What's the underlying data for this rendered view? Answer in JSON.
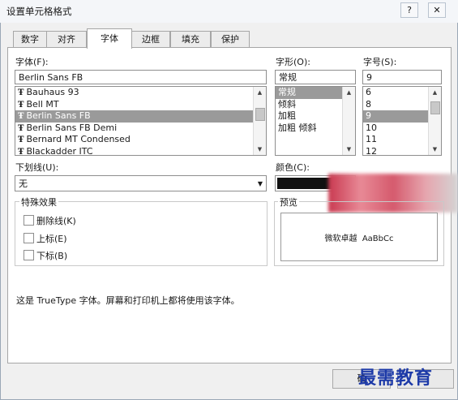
{
  "window": {
    "title": "设置单元格格式",
    "help_button": "?",
    "close_button": "✕"
  },
  "tabs": [
    {
      "label": "数字"
    },
    {
      "label": "对齐"
    },
    {
      "label": "字体"
    },
    {
      "label": "边框"
    },
    {
      "label": "填充"
    },
    {
      "label": "保护"
    }
  ],
  "font": {
    "label": "字体(F):",
    "value": "Berlin Sans FB",
    "list": [
      "Bauhaus 93",
      "Bell MT",
      "Berlin Sans FB",
      "Berlin Sans FB Demi",
      "Bernard MT Condensed",
      "Blackadder ITC"
    ],
    "selected_index": 2
  },
  "style": {
    "label": "字形(O):",
    "value": "常规",
    "list": [
      "常规",
      "倾斜",
      "加粗",
      "加粗 倾斜"
    ],
    "selected_index": 0
  },
  "size": {
    "label": "字号(S):",
    "value": "9",
    "list": [
      "6",
      "8",
      "9",
      "10",
      "11",
      "12"
    ],
    "selected_index": 2
  },
  "underline": {
    "label": "下划线(U):",
    "value": "无"
  },
  "color": {
    "label": "颜色(C):",
    "swatch": "#111111"
  },
  "effects": {
    "label": "特殊效果",
    "items": [
      {
        "label": "删除线(K)"
      },
      {
        "label": "上标(E)"
      },
      {
        "label": "下标(B)"
      }
    ]
  },
  "preview": {
    "label": "预览",
    "text": "微软卓越  AaBbCc"
  },
  "info_text": "这是 TrueType 字体。屏幕和打印机上都将使用该字体。",
  "ok_button": "确",
  "watermark": "最需教育"
}
